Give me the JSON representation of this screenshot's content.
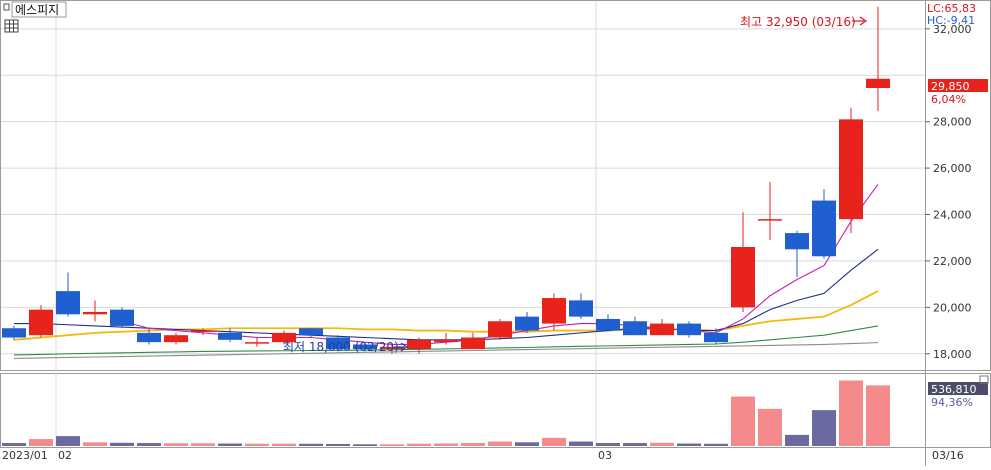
{
  "stock_name": "에스피지",
  "indicators": {
    "lc": "LC:65,83",
    "hc": "HC:-9,41"
  },
  "annotations": {
    "high": {
      "text": "최고 32,950 (03/16)",
      "value": 32950
    },
    "low": {
      "text": "최저 18,000 (02/20)",
      "value": 18000
    }
  },
  "current": {
    "price": "29,850",
    "change": "6,04%",
    "volume": "536,810",
    "volume_pct": "94,36%"
  },
  "colors": {
    "up": "#e8231b",
    "down": "#1f5fd0",
    "vol_up": "#f58a8a",
    "vol_down": "#6a6aa0",
    "ma5": "#c81eb4",
    "ma10": "#1c2d8c",
    "ma20": "#f2b90f",
    "ma60": "#2e8c4a",
    "ma120": "#8c8c8c",
    "grid": "#d9d9d9",
    "axis_text": "#333333"
  },
  "chart_data": {
    "type": "candlestick",
    "x_tick_labels": [
      "2023/01",
      "02",
      "03",
      "03/16"
    ],
    "y_ticks": [
      18000,
      20000,
      22000,
      24000,
      26000,
      28000,
      32000
    ],
    "y_tick_labels": [
      "18,000",
      "20,000",
      "22,000",
      "24,000",
      "26,000",
      "28,000",
      "32,000"
    ],
    "ylim": [
      17300,
      33200
    ],
    "candles": [
      {
        "date": "01/30",
        "open": 19100,
        "high": 19200,
        "low": 18600,
        "close": 18700
      },
      {
        "date": "01/31",
        "open": 18800,
        "high": 20100,
        "low": 18700,
        "close": 19900
      },
      {
        "date": "02/01",
        "open": 20700,
        "high": 21500,
        "low": 19600,
        "close": 19700
      },
      {
        "date": "02/02",
        "open": 19700,
        "high": 20300,
        "low": 19400,
        "close": 19800
      },
      {
        "date": "02/03",
        "open": 19900,
        "high": 20000,
        "low": 19100,
        "close": 19200
      },
      {
        "date": "02/06",
        "open": 18900,
        "high": 19100,
        "low": 18400,
        "close": 18500
      },
      {
        "date": "02/07",
        "open": 18500,
        "high": 18900,
        "low": 18400,
        "close": 18800
      },
      {
        "date": "02/08",
        "open": 19000,
        "high": 19100,
        "low": 18800,
        "close": 19000
      },
      {
        "date": "02/09",
        "open": 18900,
        "high": 19100,
        "low": 18500,
        "close": 18600
      },
      {
        "date": "02/10",
        "open": 18500,
        "high": 18700,
        "low": 18300,
        "close": 18500
      },
      {
        "date": "02/13",
        "open": 18500,
        "high": 19000,
        "low": 18400,
        "close": 18900
      },
      {
        "date": "02/14",
        "open": 19100,
        "high": 19100,
        "low": 18700,
        "close": 18800
      },
      {
        "date": "02/15",
        "open": 18700,
        "high": 18800,
        "low": 18100,
        "close": 18200
      },
      {
        "date": "02/16",
        "open": 18400,
        "high": 18500,
        "low": 18100,
        "close": 18200
      },
      {
        "date": "02/17",
        "open": 18200,
        "high": 18400,
        "low": 18000,
        "close": 18300
      },
      {
        "date": "02/20",
        "open": 18200,
        "high": 18700,
        "low": 18000,
        "close": 18600
      },
      {
        "date": "02/21",
        "open": 18500,
        "high": 18900,
        "low": 18400,
        "close": 18600
      },
      {
        "date": "02/22",
        "open": 18200,
        "high": 18900,
        "low": 18200,
        "close": 18700
      },
      {
        "date": "02/23",
        "open": 18700,
        "high": 19500,
        "low": 18600,
        "close": 19400
      },
      {
        "date": "02/24",
        "open": 19600,
        "high": 19800,
        "low": 18900,
        "close": 19000
      },
      {
        "date": "02/27",
        "open": 19300,
        "high": 20600,
        "low": 19000,
        "close": 20400
      },
      {
        "date": "02/28",
        "open": 20300,
        "high": 20600,
        "low": 19500,
        "close": 19600
      },
      {
        "date": "03/02",
        "open": 19500,
        "high": 19700,
        "low": 19000,
        "close": 19000
      },
      {
        "date": "03/03",
        "open": 19400,
        "high": 19600,
        "low": 18800,
        "close": 18800
      },
      {
        "date": "03/06",
        "open": 18800,
        "high": 19500,
        "low": 18800,
        "close": 19300
      },
      {
        "date": "03/07",
        "open": 19300,
        "high": 19400,
        "low": 18700,
        "close": 18800
      },
      {
        "date": "03/08",
        "open": 18900,
        "high": 19100,
        "low": 18400,
        "close": 18500
      },
      {
        "date": "03/09",
        "open": 20000,
        "high": 24100,
        "low": 19800,
        "close": 22600
      },
      {
        "date": "03/10",
        "open": 23800,
        "high": 25400,
        "low": 22900,
        "close": 23800
      },
      {
        "date": "03/13",
        "open": 23200,
        "high": 23300,
        "low": 21300,
        "close": 22500
      },
      {
        "date": "03/14",
        "open": 24600,
        "high": 25100,
        "low": 22100,
        "close": 22200
      },
      {
        "date": "03/15",
        "open": 23800,
        "high": 28600,
        "low": 23200,
        "close": 28100
      },
      {
        "date": "03/16",
        "open": 29450,
        "high": 32950,
        "low": 28450,
        "close": 29850
      }
    ],
    "volume": [
      12000,
      28000,
      40000,
      15000,
      13000,
      12000,
      11000,
      11000,
      10000,
      9000,
      9000,
      9000,
      8000,
      7000,
      7000,
      9000,
      10000,
      12000,
      18000,
      15000,
      33000,
      18000,
      12000,
      12000,
      13000,
      10000,
      9000,
      200000,
      150000,
      45000,
      145000,
      265000,
      245000
    ],
    "volume_max": 275000,
    "ma": {
      "ma5": [
        null,
        null,
        null,
        null,
        19400,
        19100,
        19000,
        18900,
        18800,
        18700,
        18700,
        18700,
        18600,
        18500,
        18400,
        18400,
        18500,
        18600,
        18800,
        19000,
        19200,
        19300,
        19300,
        19200,
        19100,
        19000,
        18900,
        19500,
        20500,
        21200,
        21800,
        23700,
        25300
      ],
      "ma10": [
        19300,
        19300,
        19250,
        19200,
        19150,
        19100,
        19050,
        19000,
        18950,
        18900,
        18850,
        18800,
        18750,
        18700,
        18650,
        18600,
        18600,
        18600,
        18650,
        18700,
        18800,
        18900,
        19000,
        19100,
        19100,
        19000,
        19000,
        19300,
        19900,
        20300,
        20600,
        21600,
        22500
      ],
      "ma20": [
        18600,
        18700,
        18800,
        18900,
        18950,
        19000,
        19050,
        19050,
        19100,
        19100,
        19100,
        19100,
        19100,
        19050,
        19050,
        19000,
        19000,
        18950,
        18950,
        18950,
        19000,
        19000,
        19000,
        19050,
        19050,
        19050,
        19000,
        19200,
        19400,
        19500,
        19600,
        20100,
        20700
      ],
      "ma60": [
        17950,
        17970,
        18000,
        18020,
        18040,
        18060,
        18080,
        18100,
        18110,
        18120,
        18130,
        18140,
        18150,
        18160,
        18170,
        18190,
        18210,
        18230,
        18250,
        18270,
        18300,
        18320,
        18340,
        18360,
        18380,
        18400,
        18420,
        18500,
        18600,
        18700,
        18800,
        19000,
        19200
      ],
      "ma120": [
        17800,
        17820,
        17840,
        17860,
        17880,
        17900,
        17920,
        17940,
        17960,
        17980,
        18000,
        18020,
        18040,
        18060,
        18080,
        18100,
        18120,
        18140,
        18160,
        18180,
        18200,
        18220,
        18240,
        18260,
        18280,
        18300,
        18320,
        18340,
        18360,
        18380,
        18400,
        18440,
        18480
      ]
    }
  }
}
